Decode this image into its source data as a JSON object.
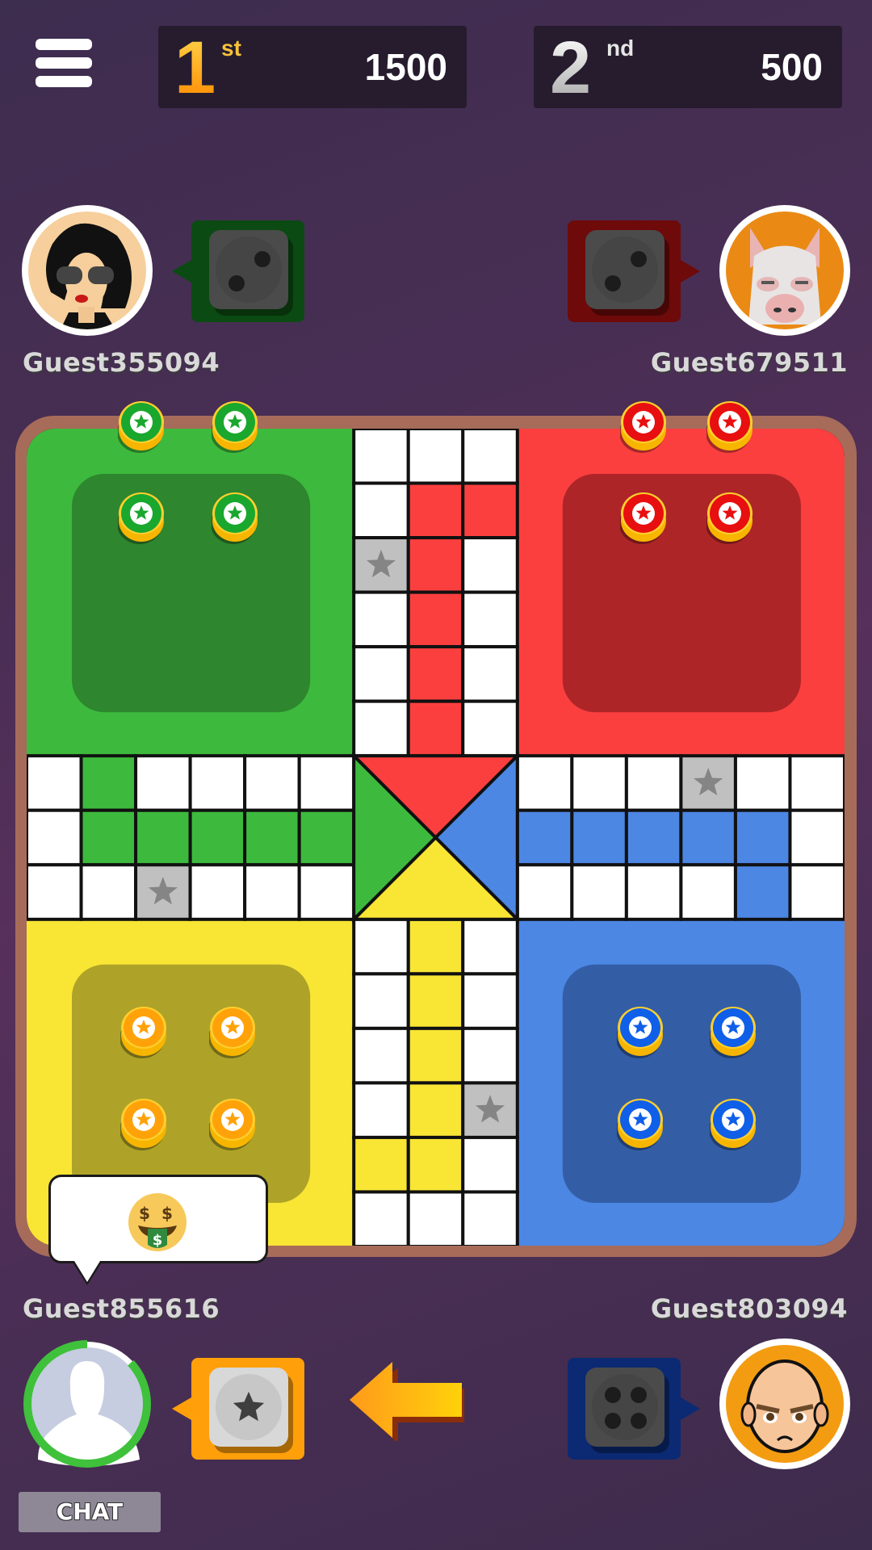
{
  "menu": {
    "icon": "hamburger-menu-icon"
  },
  "leaderboard": [
    {
      "rank": "1",
      "suffix": "st",
      "score": "1500"
    },
    {
      "rank": "2",
      "suffix": "nd",
      "score": "500"
    }
  ],
  "players": {
    "top_left": {
      "name": "Guest355094",
      "color": "green",
      "avatar": "woman-sunglasses-avatar",
      "dice_value": 2,
      "dice_bg": "#0b4a12"
    },
    "top_right": {
      "name": "Guest679511",
      "color": "red",
      "avatar": "pig-avatar",
      "dice_value": 2,
      "dice_bg": "#6e0a0a"
    },
    "bottom_left": {
      "name": "Guest855616",
      "color": "yellow",
      "avatar": "default-silhouette-avatar",
      "dice_value": "star",
      "dice_bg": "#ff9f0a",
      "turn_timer_remaining": 0.87,
      "is_current_turn": true,
      "chat_emoji": "🤑"
    },
    "bottom_right": {
      "name": "Guest803094",
      "color": "blue",
      "avatar": "bald-man-avatar",
      "dice_value": 4,
      "dice_bg": "#0b2a73"
    }
  },
  "turn_indicator": {
    "icon": "left-arrow-icon",
    "points_to": "bottom_left"
  },
  "board": {
    "colors": {
      "green": "#3dba3d",
      "red": "#fb3f3f",
      "yellow": "#f9e534",
      "blue": "#4d87e4",
      "green_dark": "#2e862e",
      "red_dark": "#ae2528",
      "yellow_dark": "#aea328",
      "blue_dark": "#335ea6",
      "safe": "#c0c0c0",
      "frame": "#a76b5a"
    },
    "tokens_at_home": {
      "green": 4,
      "red": 4,
      "yellow": 4,
      "blue": 4
    }
  },
  "chat": {
    "label": "CHAT"
  }
}
